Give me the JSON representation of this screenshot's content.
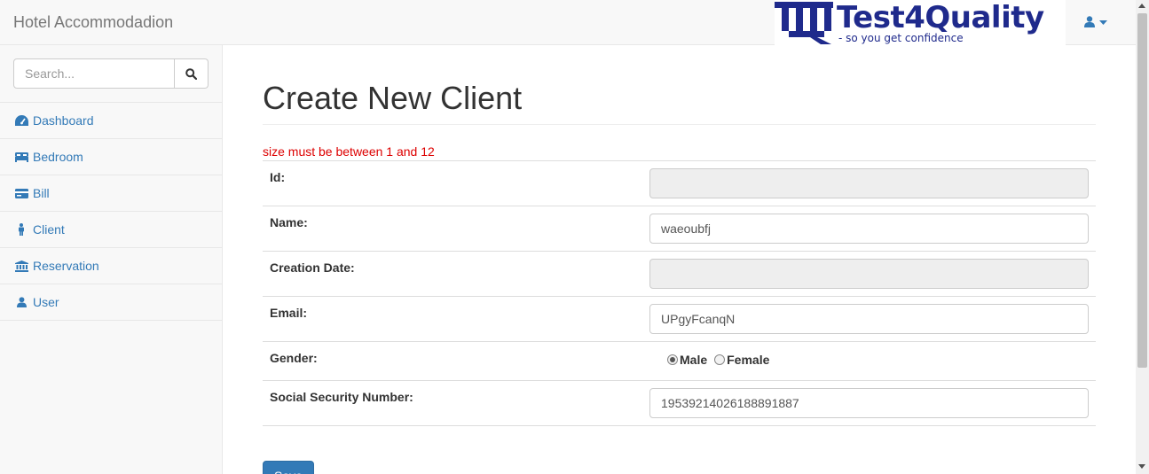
{
  "app": {
    "brand": "Hotel Accommodadion",
    "logo_word": "Test4Quality",
    "logo_tagline": "- so you get confidence"
  },
  "colors": {
    "link": "#337ab7",
    "error": "#dd0000",
    "logo": "#1f2a8c",
    "primary_button": "#337ab7"
  },
  "sidebar": {
    "search_placeholder": "Search...",
    "search_icon": "search-icon",
    "items": [
      {
        "label": "Dashboard",
        "icon": "dashboard-icon"
      },
      {
        "label": "Bedroom",
        "icon": "bed-icon"
      },
      {
        "label": "Bill",
        "icon": "credit-card-icon"
      },
      {
        "label": "Client",
        "icon": "person-icon"
      },
      {
        "label": "Reservation",
        "icon": "bank-icon"
      },
      {
        "label": "User",
        "icon": "user-icon"
      }
    ]
  },
  "main": {
    "title": "Create New Client",
    "error_message": "size must be between 1 and 12",
    "fields": {
      "id": {
        "label": "Id:",
        "value": ""
      },
      "name": {
        "label": "Name:",
        "value": "waeoubfj"
      },
      "creation_date": {
        "label": "Creation Date:",
        "value": ""
      },
      "email": {
        "label": "Email:",
        "value": "UPgyFcanqN"
      },
      "gender": {
        "label": "Gender:",
        "options": [
          "Male",
          "Female"
        ],
        "selected": "Male"
      },
      "ssn": {
        "label": "Social Security Number:",
        "value": "19539214026188891887"
      }
    },
    "save_label": "Save"
  }
}
